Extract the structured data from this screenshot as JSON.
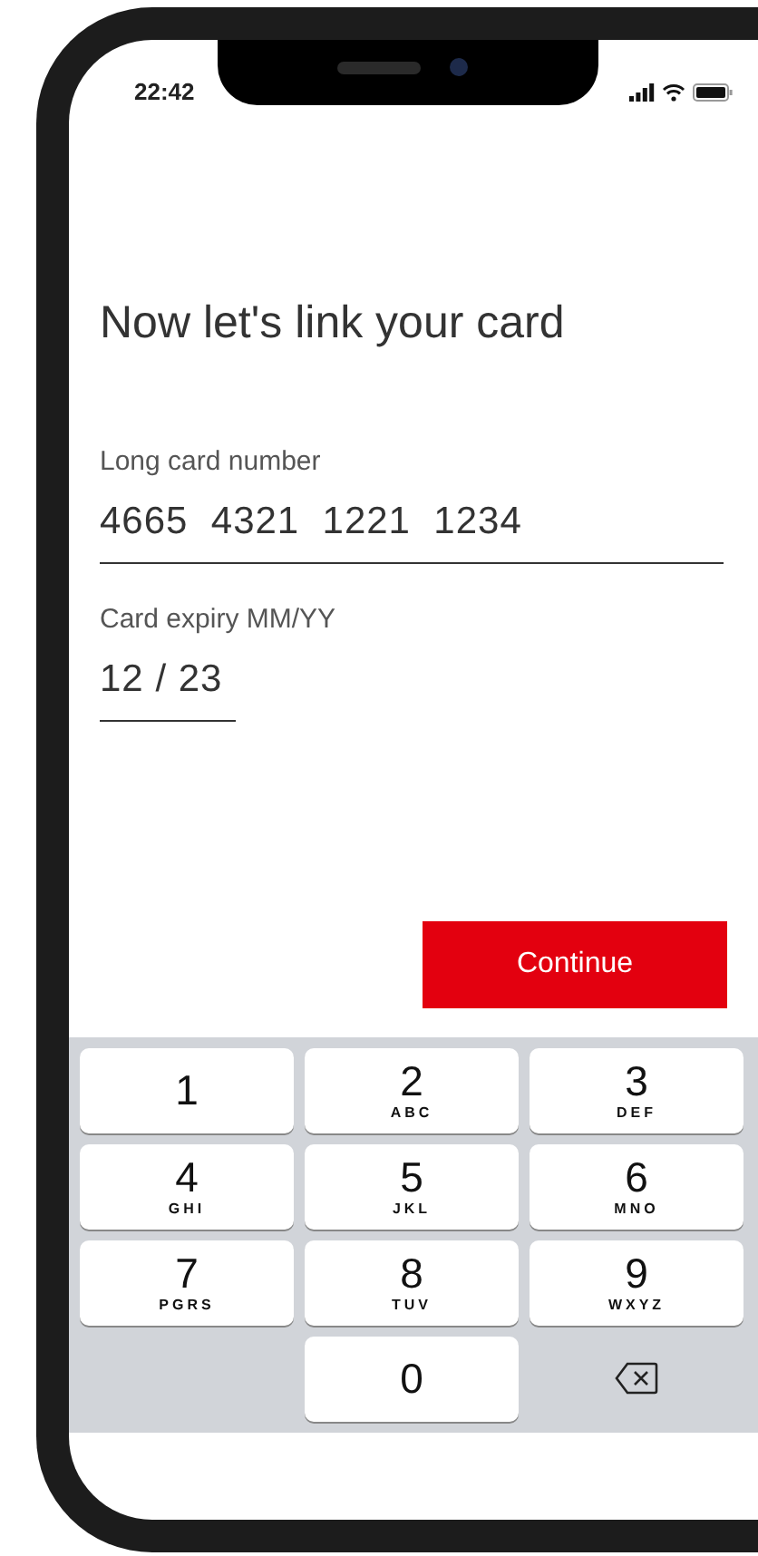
{
  "status_bar": {
    "time": "22:42"
  },
  "title": "Now let's link your card",
  "fields": [
    {
      "label": "Long card number",
      "value": "4665  4321  1221  1234",
      "kind": "card_number"
    },
    {
      "label": "Card expiry MM/YY",
      "value": "12 / 23",
      "kind": "expiry"
    }
  ],
  "continue_button": "Continue",
  "keypad": [
    {
      "digit": "1"
    },
    {
      "digit": "2",
      "letters": "ABC"
    },
    {
      "digit": "3",
      "letters": "DEF"
    },
    {
      "digit": "4",
      "letters": "GHI"
    },
    {
      "digit": "5",
      "letters": "JKL"
    },
    {
      "digit": "6",
      "letters": "MNO"
    },
    {
      "digit": "7",
      "letters": "PGRS"
    },
    {
      "digit": "8",
      "letters": "TUV"
    },
    {
      "digit": "9",
      "letters": "WXYZ"
    },
    {
      "kind": "blank"
    },
    {
      "digit": "0"
    },
    {
      "kind": "delete"
    }
  ]
}
